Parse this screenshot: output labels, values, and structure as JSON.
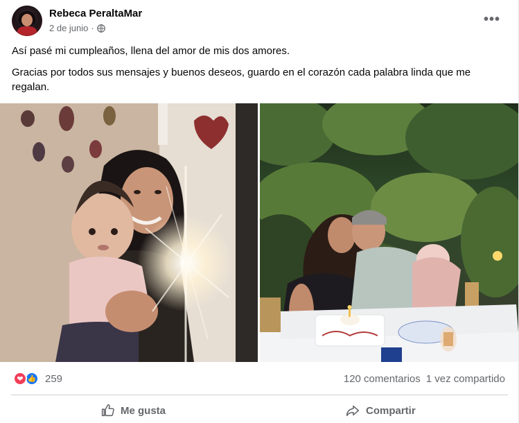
{
  "post": {
    "author": "Rebeca PeraltaMar",
    "date": "2 de junio",
    "separator": "·",
    "privacy_icon": "globe-icon",
    "more_icon": "more-options-icon",
    "paragraphs": [
      "Así pasé mi cumpleaños, llena del amor de mis dos amores.",
      "Gracias por todos sus mensajes y buenos deseos, guardo en el corazón cada palabra linda que me regalan."
    ],
    "photos": [
      {
        "name": "photo-mother-baby-sparkler",
        "icon": "photo-thumbnail"
      },
      {
        "name": "photo-couple-kiss-dinner",
        "icon": "photo-thumbnail"
      }
    ]
  },
  "reactions": {
    "icons": [
      "heart-icon",
      "like-icon"
    ],
    "count": "259"
  },
  "stats": {
    "comments": "120 comentarios",
    "shares": "1 vez compartido"
  },
  "actions": {
    "like_label": "Me gusta",
    "share_label": "Compartir"
  },
  "colors": {
    "brand_blue": "#1877f2",
    "love_red": "#f33e58",
    "secondary_text": "#65676b",
    "divider": "#ced0d4"
  }
}
